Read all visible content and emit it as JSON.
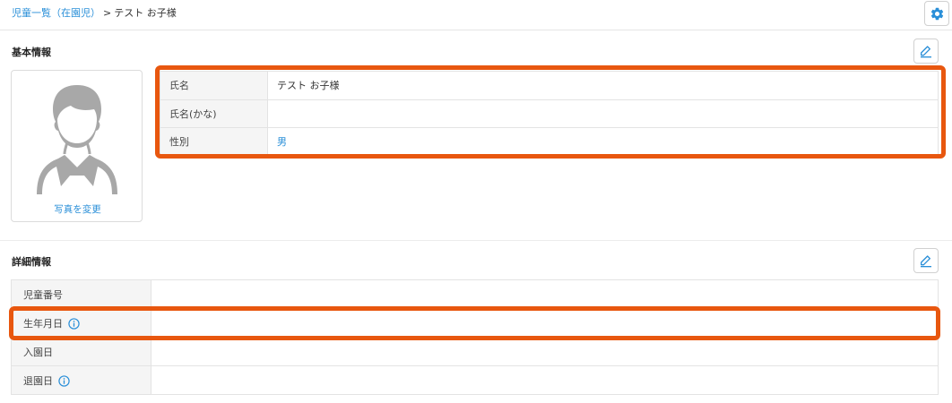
{
  "breadcrumb": {
    "parent": "児童一覧（在園児）",
    "separator": ">",
    "current": "テスト お子様"
  },
  "basic_info": {
    "title": "基本情報",
    "photo_change_label": "写真を変更",
    "rows": [
      {
        "label": "氏名",
        "value": "テスト お子様"
      },
      {
        "label": "氏名(かな)",
        "value": ""
      },
      {
        "label": "性別",
        "value": "男"
      }
    ]
  },
  "detail_info": {
    "title": "詳細情報",
    "rows": [
      {
        "label": "児童番号",
        "value": ""
      },
      {
        "label": "生年月日",
        "value": ""
      },
      {
        "label": "入園日",
        "value": ""
      },
      {
        "label": "退園日",
        "value": ""
      }
    ]
  },
  "icons": {
    "settings": "gear-icon",
    "edit": "pencil-icon",
    "info": "info-icon",
    "avatar": "person-silhouette"
  },
  "colors": {
    "accent": "#2a8fd8",
    "highlight": "#e8570f",
    "label_bg": "#f5f5f5",
    "avatar": "#a8a8a8"
  }
}
